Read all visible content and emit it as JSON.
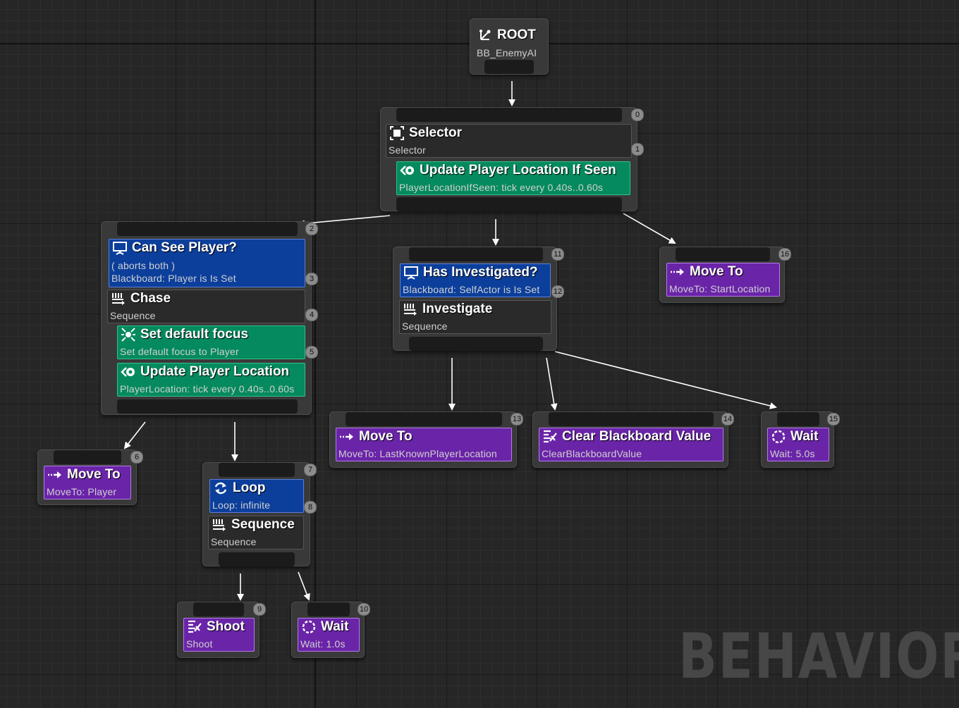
{
  "watermark": "BEHAVIOR",
  "colors": {
    "composite": "#2a2a2a",
    "decorator": "#0c3f9c",
    "service": "#048a5e",
    "task": "#6a24a8",
    "background": "#262626"
  },
  "root": {
    "title": "ROOT",
    "subtitle": "BB_EnemyAI",
    "icon": "root-icon"
  },
  "selector_node": {
    "badge_top": "0",
    "composite": {
      "title": "Selector",
      "subtitle": "Selector",
      "badge": "1",
      "icon": "selector-icon"
    },
    "service": {
      "title": "Update Player Location If Seen",
      "subtitle": "PlayerLocationIfSeen: tick every 0.40s..0.60s",
      "icon": "service-icon"
    }
  },
  "chase_node": {
    "badge_top": "2",
    "decorator": {
      "title": "Can See Player?",
      "line1": "( aborts both )",
      "line2": "Blackboard: Player is Is Set",
      "badge": "3",
      "icon": "decorator-icon"
    },
    "composite": {
      "title": "Chase",
      "subtitle": "Sequence",
      "badge": "4",
      "icon": "sequence-icon"
    },
    "service1": {
      "title": "Set default focus",
      "subtitle": "Set default focus to Player",
      "badge": "5",
      "icon": "focus-icon"
    },
    "service2": {
      "title": "Update Player Location",
      "subtitle": "PlayerLocation: tick every 0.40s..0.60s",
      "icon": "service-icon"
    }
  },
  "moveto_player": {
    "badge": "6",
    "title": "Move To",
    "subtitle": "MoveTo: Player",
    "icon": "moveto-icon"
  },
  "loop_node": {
    "badge_top": "7",
    "decorator": {
      "title": "Loop",
      "subtitle": "Loop: infinite",
      "badge": "8",
      "icon": "loop-icon"
    },
    "composite": {
      "title": "Sequence",
      "subtitle": "Sequence",
      "icon": "sequence-icon"
    }
  },
  "shoot": {
    "badge": "9",
    "title": "Shoot",
    "subtitle": "Shoot",
    "icon": "task-icon"
  },
  "wait_short": {
    "badge": "10",
    "title": "Wait",
    "subtitle": "Wait: 1.0s",
    "icon": "wait-icon"
  },
  "investigate_node": {
    "badge_top": "11",
    "decorator": {
      "title": "Has Investigated?",
      "subtitle": "Blackboard: SelfActor is Is Set",
      "badge": "12",
      "icon": "decorator-icon"
    },
    "composite": {
      "title": "Investigate",
      "subtitle": "Sequence",
      "icon": "sequence-icon"
    }
  },
  "moveto_last": {
    "badge": "13",
    "title": "Move To",
    "subtitle": "MoveTo: LastKnownPlayerLocation",
    "icon": "moveto-icon"
  },
  "clear_bb": {
    "badge": "14",
    "title": "Clear Blackboard Value",
    "subtitle": "ClearBlackboardValue",
    "icon": "task-icon"
  },
  "wait_long": {
    "badge": "15",
    "title": "Wait",
    "subtitle": "Wait: 5.0s",
    "icon": "wait-icon"
  },
  "moveto_start": {
    "badge": "16",
    "title": "Move To",
    "subtitle": "MoveTo: StartLocation",
    "icon": "moveto-icon"
  }
}
